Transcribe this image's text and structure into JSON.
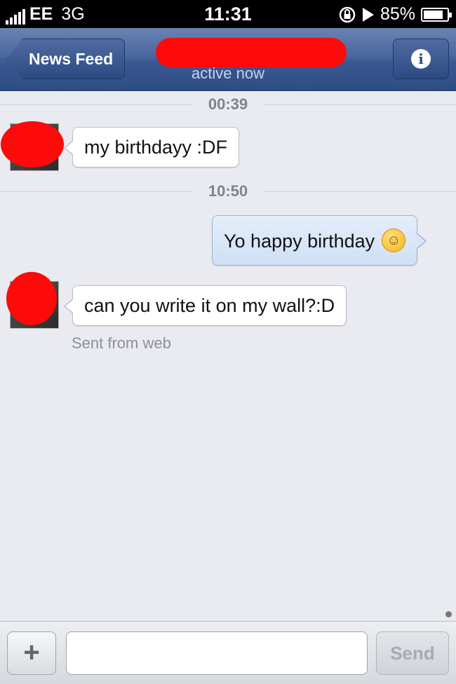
{
  "status_bar": {
    "carrier": "EE",
    "network": "3G",
    "time": "11:31",
    "battery": "85%",
    "battery_level": 0.85
  },
  "nav": {
    "back_label": "News Feed",
    "subtitle": "active now",
    "info_icon": "i"
  },
  "conversation": {
    "timestamps": [
      "00:39",
      "10:50"
    ],
    "messages": [
      {
        "from": "them",
        "text": "my birthdayy :DF"
      },
      {
        "from": "me",
        "text": "Yo happy birthday",
        "emoji": "smiling-face-icon"
      },
      {
        "from": "them",
        "text": "can you write it on my wall?:D"
      }
    ],
    "sent_from": "Sent from web"
  },
  "composer": {
    "plus_label": "+",
    "input_value": "",
    "send_label": "Send"
  },
  "colors": {
    "nav_bar": "#3a5891",
    "redaction": "#ff0a0a",
    "background": "#e9ebf0"
  }
}
